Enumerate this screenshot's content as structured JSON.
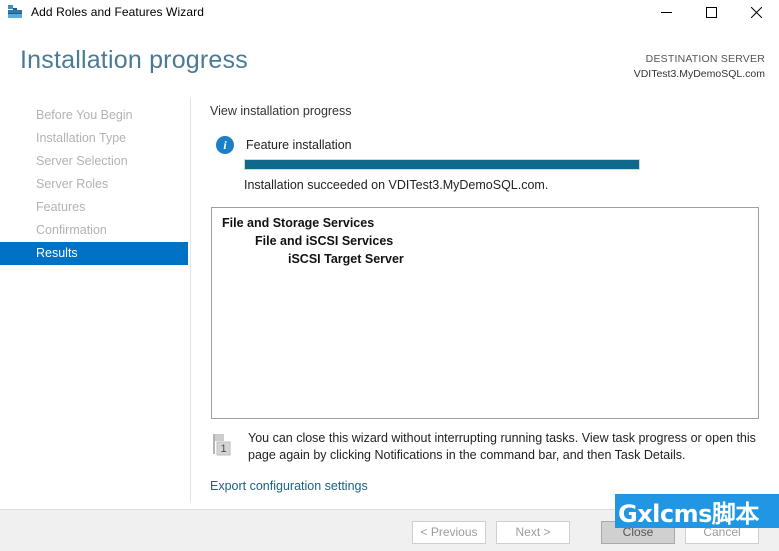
{
  "window": {
    "title": "Add Roles and Features Wizard",
    "app_icon": "wizard-toolbox-icon",
    "controls": {
      "minimize": "minimize-icon",
      "maximize": "maximize-icon",
      "close": "close-icon"
    }
  },
  "header": {
    "page_title": "Installation progress",
    "destination_label": "DESTINATION SERVER",
    "destination_value": "VDITest3.MyDemoSQL.com"
  },
  "sidebar": {
    "items": [
      {
        "label": "Before You Begin",
        "active": false
      },
      {
        "label": "Installation Type",
        "active": false
      },
      {
        "label": "Server Selection",
        "active": false
      },
      {
        "label": "Server Roles",
        "active": false
      },
      {
        "label": "Features",
        "active": false
      },
      {
        "label": "Confirmation",
        "active": false
      },
      {
        "label": "Results",
        "active": true
      }
    ]
  },
  "main": {
    "section_title": "View installation progress",
    "feature_label": "Feature installation",
    "info_icon": "info-circle-icon",
    "info_glyph": "i",
    "progress_percent": 100,
    "progress_status": "Installation succeeded on VDITest3.MyDemoSQL.com.",
    "results": [
      {
        "label": "File and Storage Services",
        "level": 0
      },
      {
        "label": "File and iSCSI Services",
        "level": 1
      },
      {
        "label": "iSCSI Target Server",
        "level": 2
      }
    ],
    "notice_icon": "notification-flag-icon",
    "notice_badge": "1",
    "notice_line1": "You can close this wizard without interrupting running tasks. View task progress or open this",
    "notice_line2": "page again by clicking Notifications in the command bar, and then Task Details.",
    "export_link": "Export configuration settings"
  },
  "footer": {
    "previous": "< Previous",
    "next": "Next >",
    "close": "Close",
    "cancel": "Cancel"
  },
  "watermark": {
    "text": "Gxlcms脚本"
  },
  "colors": {
    "accent_blue": "#0072c6",
    "progress_teal": "#10688a",
    "title_blue": "#4a7b95",
    "link_blue": "#1a6383",
    "watermark_blue": "#2196e3"
  }
}
